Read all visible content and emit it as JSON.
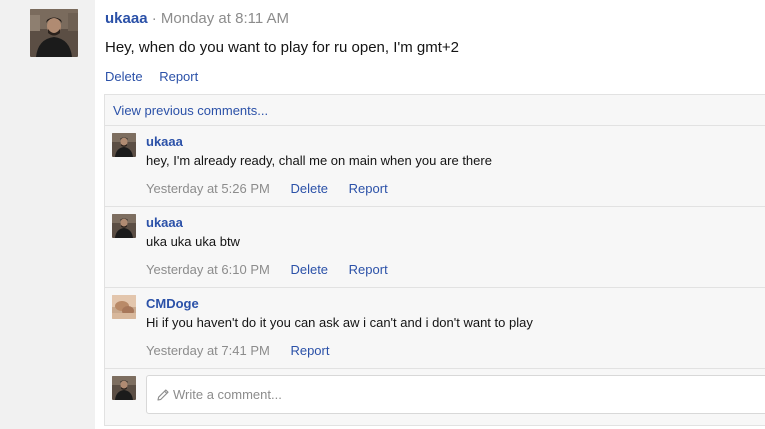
{
  "post": {
    "user": "ukaaa",
    "separator": "·",
    "time": "Monday at 8:11 AM",
    "text": "Hey, when do you want to play for ru open, I'm gmt+2",
    "actions": {
      "delete": "Delete",
      "report": "Report"
    }
  },
  "comments": {
    "view_previous": "View previous comments...",
    "items": [
      {
        "user": "ukaaa",
        "text": "hey, I'm already ready, chall me on main when you are there",
        "time": "Yesterday at 5:26 PM",
        "delete": "Delete",
        "report": "Report"
      },
      {
        "user": "ukaaa",
        "text": "uka uka uka btw",
        "time": "Yesterday at 6:10 PM",
        "delete": "Delete",
        "report": "Report"
      },
      {
        "user": "CMDoge",
        "text": "Hi if you haven't do it you can ask aw i can't and i don't want to play",
        "time": "Yesterday at 7:41 PM",
        "report": "Report"
      }
    ],
    "write": {
      "placeholder": "Write a comment..."
    }
  },
  "colors": {
    "link": "#2b51a8",
    "muted": "#8c8c8c",
    "panel": "#f7f7f7"
  },
  "icons": {
    "write": "pencil-icon"
  }
}
